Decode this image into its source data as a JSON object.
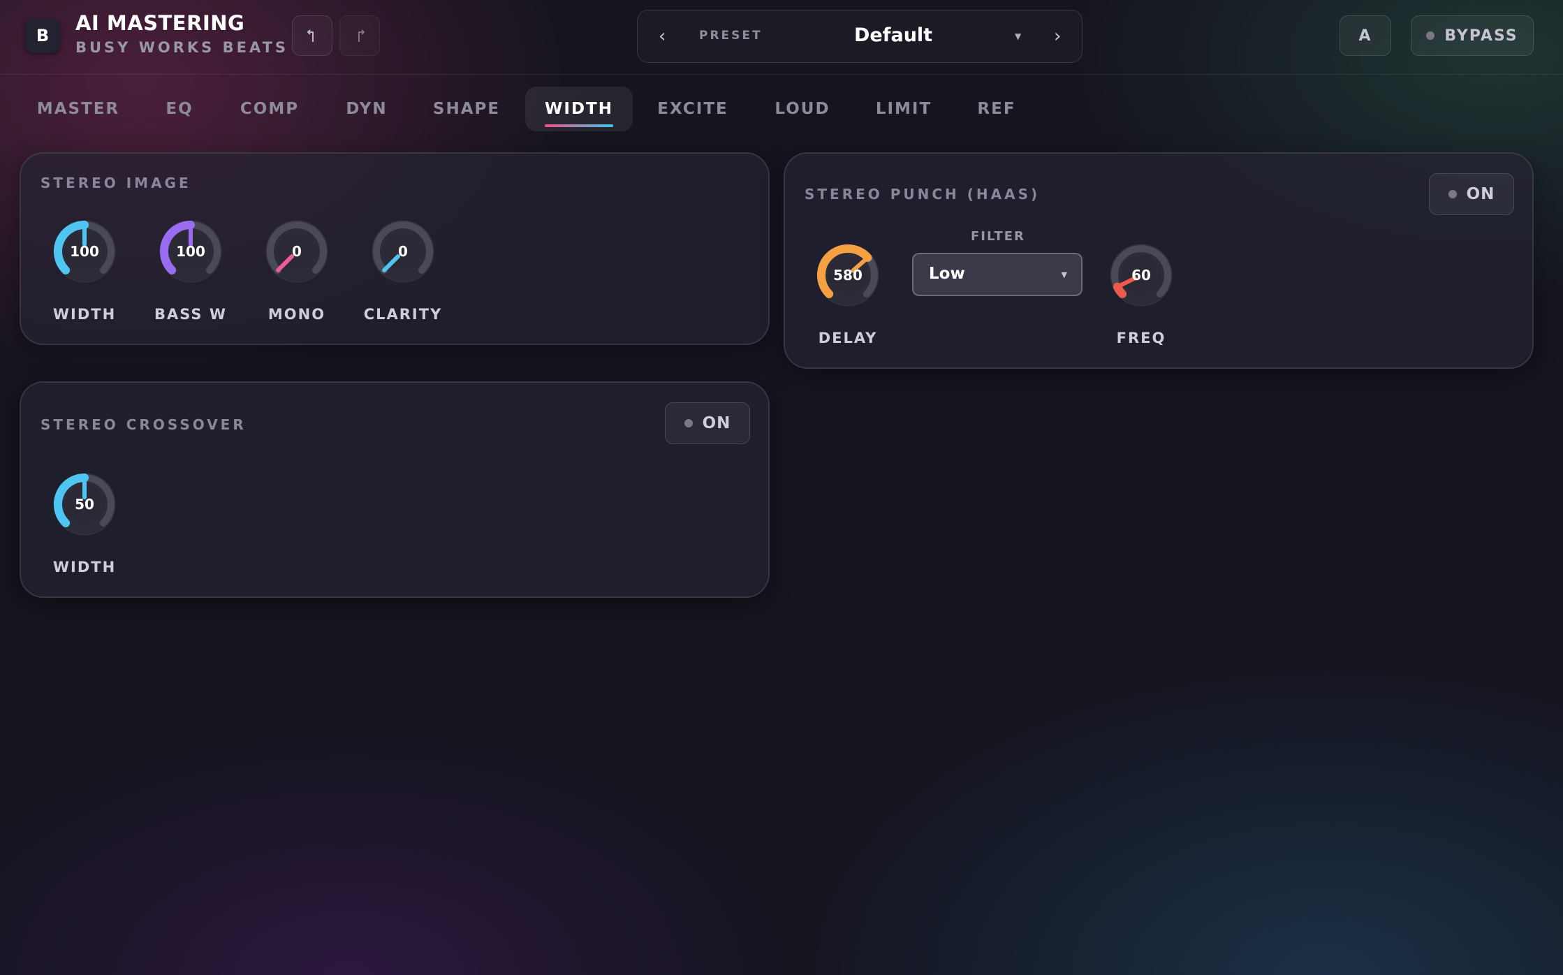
{
  "header": {
    "logo_letter": "B",
    "title": "AI MASTERING",
    "subtitle": "BUSY WORKS BEATS",
    "undo_icon": "undo-icon",
    "redo_icon": "redo-icon",
    "preset": {
      "label": "PRESET",
      "value": "Default",
      "prev_icon": "chevron-left-icon",
      "next_icon": "chevron-right-icon"
    },
    "ab_label": "A",
    "bypass_label": "BYPASS"
  },
  "tabs": [
    "MASTER",
    "EQ",
    "COMP",
    "DYN",
    "SHAPE",
    "WIDTH",
    "EXCITE",
    "LOUD",
    "LIMIT",
    "REF"
  ],
  "active_tab": "WIDTH",
  "stereo_image": {
    "title": "STEREO IMAGE",
    "knobs": [
      {
        "label": "WIDTH",
        "value": "100",
        "level": 0.5,
        "color": "#4fc6f2"
      },
      {
        "label": "BASS W",
        "value": "100",
        "level": 0.5,
        "color": "#9a6cf2"
      },
      {
        "label": "MONO",
        "value": "0",
        "level": 0.0,
        "color": "#ef5b9c"
      },
      {
        "label": "CLARITY",
        "value": "0",
        "level": 0.0,
        "color": "#4fc6f2"
      }
    ]
  },
  "stereo_punch": {
    "title": "STEREO PUNCH (HAAS)",
    "toggle_label": "ON",
    "filter_label": "FILTER",
    "filter_value": "Low",
    "delay": {
      "label": "DELAY",
      "value": "580",
      "level": 0.68,
      "color": "#f5a142"
    },
    "freq": {
      "label": "FREQ",
      "value": "60",
      "level": 0.07,
      "color": "#ee5a4a"
    }
  },
  "stereo_crossover": {
    "title": "STEREO CROSSOVER",
    "toggle_label": "ON",
    "knob": {
      "label": "WIDTH",
      "value": "50",
      "level": 0.5,
      "color": "#4fc6f2"
    }
  }
}
